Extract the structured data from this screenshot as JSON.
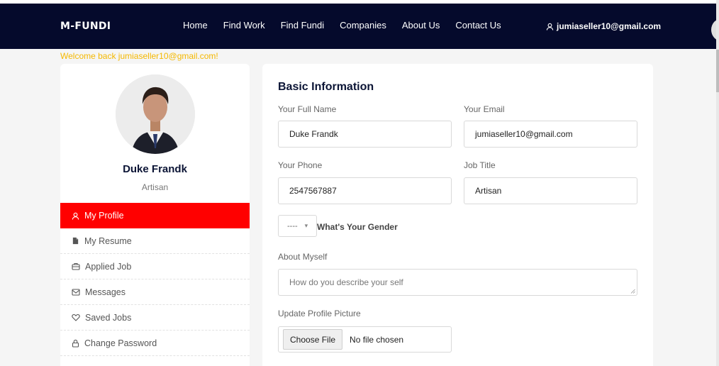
{
  "brand": "M-FUNDI",
  "nav": {
    "links": [
      "Home",
      "Find Work",
      "Find Fundi",
      "Companies",
      "About Us",
      "Contact Us"
    ],
    "user_email": "jumiaseller10@gmail.com"
  },
  "welcome": "Welcome back jumiaseller10@gmail.com!",
  "profile": {
    "name": "Duke Frandk",
    "role": "Artisan"
  },
  "menu": [
    {
      "label": "My Profile",
      "icon": "user-icon",
      "active": true
    },
    {
      "label": "My Resume",
      "icon": "file-icon"
    },
    {
      "label": "Applied Job",
      "icon": "briefcase-icon"
    },
    {
      "label": "Messages",
      "icon": "mail-icon"
    },
    {
      "label": "Saved Jobs",
      "icon": "heart-icon"
    },
    {
      "label": "Change Password",
      "icon": "lock-icon"
    }
  ],
  "form": {
    "title": "Basic Information",
    "full_name_label": "Your Full Name",
    "full_name_value": "Duke Frandk",
    "email_label": "Your Email",
    "email_value": "jumiaseller10@gmail.com",
    "phone_label": "Your Phone",
    "phone_value": "2547567887",
    "job_title_label": "Job Title",
    "job_title_value": "Artisan",
    "gender_value": "----",
    "gender_label": "What's Your Gender",
    "about_label": "About Myself",
    "about_placeholder": "How do you describe your self",
    "picture_label": "Update Profile Picture",
    "choose_file": "Choose File",
    "no_file": "No file chosen"
  },
  "colors": {
    "navbar": "#050a2c",
    "accent": "#ff0000",
    "welcome": "#f5b800"
  }
}
